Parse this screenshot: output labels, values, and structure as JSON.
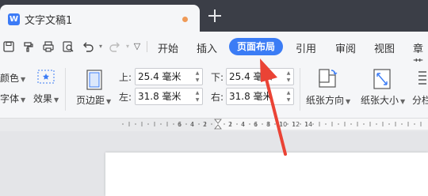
{
  "window": {
    "tab_title": "文字文稿1",
    "doc_icon_letter": "W",
    "new_tab_icon": "plus-icon"
  },
  "quick_access": {
    "icons": [
      "save-icon",
      "format-painter-icon",
      "print-icon",
      "print-preview-icon",
      "undo-icon",
      "redo-icon",
      "more-icon"
    ]
  },
  "menu": {
    "items": [
      "开始",
      "插入",
      "页面布局",
      "引用",
      "审阅",
      "视图",
      "章节"
    ],
    "active": "页面布局",
    "active_color": "#3b7cf5"
  },
  "ribbon": {
    "left_items": {
      "color": "颜色",
      "font": "字体",
      "effect": "效果"
    },
    "margins_button": "页边距",
    "margins": {
      "top_label": "上:",
      "top_value": "25.4 毫米",
      "bottom_label": "下:",
      "bottom_value": "25.4 毫米",
      "left_label": "左:",
      "left_value": "31.8 毫米",
      "right_label": "右:",
      "right_value": "31.8 毫米"
    },
    "orientation": "纸张方向",
    "size": "纸张大小",
    "columns": "分栏"
  },
  "ruler": {
    "labels": [
      "6",
      "4",
      "2",
      "2",
      "4",
      "6",
      "8",
      "10",
      "12",
      "14"
    ]
  },
  "annotation": {
    "color": "#ea4335"
  }
}
